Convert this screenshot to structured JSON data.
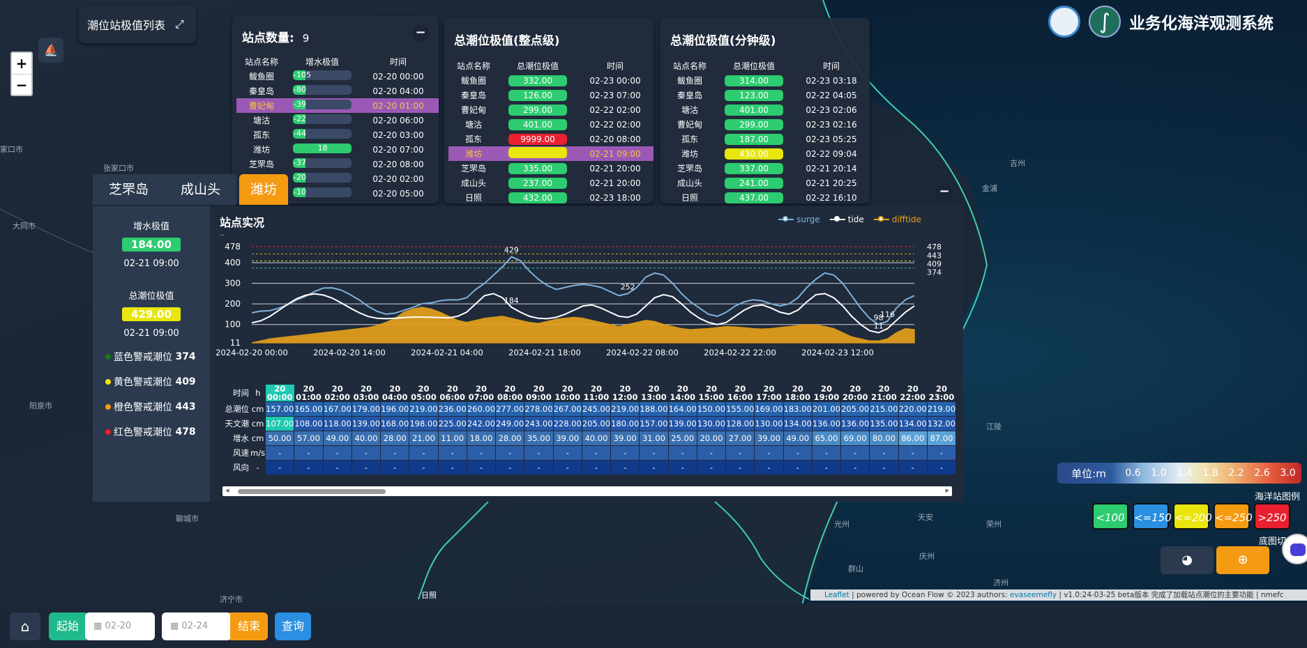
{
  "top_left_button": "潮位站极值列表",
  "zoom": {
    "plus": "+",
    "minus": "−"
  },
  "map_labels": [
    {
      "text": "张家口市"
    },
    {
      "text": "大同市"
    },
    {
      "text": "阳泉市"
    },
    {
      "text": "聊城市"
    },
    {
      "text": "济宁市"
    },
    {
      "text": "吉州"
    },
    {
      "text": "金浦"
    },
    {
      "text": "江陵"
    },
    {
      "text": "光州"
    },
    {
      "text": "济州"
    },
    {
      "text": "日照"
    },
    {
      "text": "天安"
    },
    {
      "text": "荣州"
    },
    {
      "text": "群山"
    },
    {
      "text": "庆州"
    },
    {
      "text": "家口市"
    }
  ],
  "panel_count": {
    "title": "站点数量:",
    "count": "9",
    "headers": [
      "站点名称",
      "增水极值",
      "时间"
    ],
    "rows": [
      {
        "name": "鲅鱼圈",
        "value": "-105",
        "fill": 0.05,
        "time": "02-20 00:00"
      },
      {
        "name": "秦皇岛",
        "value": "-80",
        "fill": 0.08,
        "time": "02-20 04:00"
      },
      {
        "name": "曹妃甸",
        "value": "-39",
        "fill": 0.05,
        "time": "02-20 01:00",
        "highlight": true
      },
      {
        "name": "塘沽",
        "value": "-22",
        "fill": 0.05,
        "time": "02-20 06:00"
      },
      {
        "name": "孤东",
        "value": "-44",
        "fill": 0.05,
        "time": "02-20 03:00"
      },
      {
        "name": "潍坊",
        "value": "18",
        "fill": 1.0,
        "time": "02-20 07:00"
      },
      {
        "name": "芝罘岛",
        "value": "-37",
        "fill": 0.05,
        "time": "02-20 08:00"
      },
      {
        "name": "成山头",
        "value": "-20",
        "fill": 0.05,
        "time": "02-20 02:00"
      },
      {
        "name": "日照",
        "value": "-10",
        "fill": 0.05,
        "time": "02-20 05:00"
      }
    ]
  },
  "panel_hour": {
    "title": "总潮位极值(整点级)",
    "headers": [
      "站点名称",
      "总潮位极值",
      "时间"
    ],
    "rows": [
      {
        "name": "鲅鱼圈",
        "value": "332.00",
        "color": "green",
        "time": "02-23 00:00"
      },
      {
        "name": "秦皇岛",
        "value": "126.00",
        "color": "green",
        "time": "02-23 07:00"
      },
      {
        "name": "曹妃甸",
        "value": "299.00",
        "color": "green",
        "time": "02-22 02:00"
      },
      {
        "name": "塘沽",
        "value": "401.00",
        "color": "green",
        "time": "02-22 02:00"
      },
      {
        "name": "孤东",
        "value": "9999.00",
        "color": "red",
        "time": "02-20 08:00"
      },
      {
        "name": "潍坊",
        "value": "",
        "color": "yellow",
        "time": "02-21 09:00",
        "highlight": true
      },
      {
        "name": "芝罘岛",
        "value": "335.00",
        "color": "green",
        "time": "02-21 20:00"
      },
      {
        "name": "成山头",
        "value": "237.00",
        "color": "green",
        "time": "02-21 20:00"
      },
      {
        "name": "日照",
        "value": "432.00",
        "color": "green",
        "time": "02-23 18:00"
      }
    ]
  },
  "panel_min": {
    "title": "总潮位极值(分钟级)",
    "headers": [
      "站点名称",
      "总潮位极值",
      "时间"
    ],
    "rows": [
      {
        "name": "鲅鱼圈",
        "value": "314.00",
        "color": "green",
        "time": "02-23 03:18"
      },
      {
        "name": "秦皇岛",
        "value": "123.00",
        "color": "green",
        "time": "02-22 04:05"
      },
      {
        "name": "塘沽",
        "value": "401.00",
        "color": "green",
        "time": "02-23 02:06"
      },
      {
        "name": "曹妃甸",
        "value": "299.00",
        "color": "green",
        "time": "02-23 02:16"
      },
      {
        "name": "孤东",
        "value": "187.00",
        "color": "green",
        "time": "02-23 05:25"
      },
      {
        "name": "潍坊",
        "value": "430.00",
        "color": "yellow",
        "time": "02-22 09:04"
      },
      {
        "name": "芝罘岛",
        "value": "337.00",
        "color": "green",
        "time": "02-21 20:14"
      },
      {
        "name": "成山头",
        "value": "241.00",
        "color": "green",
        "time": "02-21 20:25"
      },
      {
        "name": "日照",
        "value": "437.00",
        "color": "green",
        "time": "02-22 16:10"
      }
    ]
  },
  "tabs": [
    "芝罘岛",
    "成山头",
    "潍坊"
  ],
  "active_tab": 2,
  "station_info": {
    "surge_label": "增水极值",
    "surge_value": "184.00",
    "surge_time": "02-21 09:00",
    "total_label": "总潮位极值",
    "total_value": "429.00",
    "total_time": "02-21 09:00",
    "warnings": [
      {
        "label": "蓝色警戒潮位",
        "value": "374",
        "color": "#1a7a1a"
      },
      {
        "label": "黄色警戒潮位",
        "value": "409",
        "color": "#f2e60a"
      },
      {
        "label": "橙色警戒潮位",
        "value": "443",
        "color": "#f59b12"
      },
      {
        "label": "红色警戒潮位",
        "value": "478",
        "color": "#e8202f"
      }
    ]
  },
  "chart_title": "站点实况",
  "chart_subtitle": "--",
  "chart_data": {
    "type": "line",
    "legend": [
      "surge",
      "tide",
      "difftide"
    ],
    "xlabels": [
      "2024-02-20 00:00",
      "2024-02-20 14:00",
      "2024-02-21 04:00",
      "2024-02-21 18:00",
      "2024-02-22 08:00",
      "2024-02-22 22:00",
      "2024-02-23 12:00"
    ],
    "yticks": [
      11,
      100,
      200,
      300,
      400,
      478
    ],
    "ylim": [
      11,
      478
    ],
    "thresholds": [
      {
        "value": 478,
        "color": "#e8202f",
        "label": "478"
      },
      {
        "value": 443,
        "color": "#f59b12",
        "label": "443"
      },
      {
        "value": 409,
        "color": "#e8e60d",
        "label": "409"
      },
      {
        "value": 374,
        "color": "#1fc9b3",
        "label": "374"
      }
    ],
    "annotations": [
      {
        "label": "429"
      },
      {
        "label": "184"
      },
      {
        "label": "252"
      },
      {
        "label": "116"
      },
      {
        "label": "11"
      },
      {
        "label": "98"
      }
    ],
    "series": [
      {
        "name": "surge",
        "color": "#7fb2d9",
        "values": [
          157,
          165,
          167,
          179,
          196,
          219,
          236,
          260,
          277,
          278,
          267,
          245,
          219,
          188,
          164,
          150,
          155,
          169,
          183,
          201,
          205,
          215,
          220,
          219,
          230,
          270,
          300,
          340,
          380,
          429,
          410,
          360,
          320,
          290,
          270,
          280,
          290,
          295,
          290,
          280,
          260,
          240,
          250,
          280,
          330,
          350,
          340,
          300,
          250,
          210,
          180,
          150,
          140,
          160,
          190,
          210,
          220,
          215,
          200,
          190,
          200,
          230,
          280,
          320,
          350,
          340,
          300,
          240,
          180,
          130,
          100,
          116,
          180,
          220,
          240
        ]
      },
      {
        "name": "tide",
        "color": "#ffffff",
        "values": [
          108,
          118,
          139,
          168,
          198,
          225,
          242,
          249,
          243,
          228,
          205,
          180,
          157,
          139,
          130,
          128,
          130,
          134,
          136,
          136,
          135,
          134,
          132,
          140,
          160,
          200,
          240,
          250,
          230,
          184,
          160,
          140,
          130,
          128,
          135,
          150,
          170,
          190,
          195,
          180,
          160,
          140,
          135,
          150,
          190,
          230,
          245,
          235,
          200,
          160,
          130,
          110,
          100,
          110,
          140,
          170,
          190,
          195,
          180,
          160,
          150,
          170,
          210,
          245,
          250,
          230,
          190,
          140,
          100,
          70,
          60,
          80,
          120,
          160,
          190
        ]
      },
      {
        "name": "difftide",
        "color": "#e8a21a",
        "values": [
          11,
          20,
          30,
          35,
          40,
          45,
          50,
          55,
          60,
          65,
          70,
          75,
          80,
          85,
          95,
          110,
          130,
          160,
          175,
          184,
          175,
          160,
          140,
          120,
          110,
          120,
          130,
          135,
          140,
          130,
          120,
          110,
          105,
          115,
          125,
          130,
          135,
          130,
          120,
          110,
          100,
          90,
          100,
          110,
          120,
          115,
          100,
          90,
          80,
          75,
          78,
          80,
          85,
          90,
          88,
          84,
          80,
          78,
          80,
          85,
          90,
          95,
          100,
          98,
          90,
          80,
          60,
          40,
          30,
          20,
          20,
          30,
          60,
          80,
          75
        ]
      }
    ]
  },
  "data_table": {
    "headers": [
      "20\n00:00",
      "20\n01:00",
      "20\n02:00",
      "20\n03:00",
      "20\n04:00",
      "20\n05:00",
      "20\n06:00",
      "20\n07:00",
      "20\n08:00",
      "20\n09:00",
      "20\n10:00",
      "20\n11:00",
      "20\n12:00",
      "20\n13:00",
      "20\n14:00",
      "20\n15:00",
      "20\n16:00",
      "20\n17:00",
      "20\n18:00",
      "20\n19:00",
      "20\n20:00",
      "20\n21:00",
      "20\n22:00",
      "20\n23:00"
    ],
    "rows": [
      {
        "label": "时间",
        "unit": "h"
      },
      {
        "label": "总潮位",
        "unit": "cm",
        "values": [
          "157.00",
          "165.00",
          "167.00",
          "179.00",
          "196.00",
          "219.00",
          "236.00",
          "260.00",
          "277.00",
          "278.00",
          "267.00",
          "245.00",
          "219.00",
          "188.00",
          "164.00",
          "150.00",
          "155.00",
          "169.00",
          "183.00",
          "201.00",
          "205.00",
          "215.00",
          "220.00",
          "219.00"
        ]
      },
      {
        "label": "天文潮",
        "unit": "cm",
        "values": [
          "107.00",
          "108.00",
          "118.00",
          "139.00",
          "168.00",
          "198.00",
          "225.00",
          "242.00",
          "249.00",
          "243.00",
          "228.00",
          "205.00",
          "180.00",
          "157.00",
          "139.00",
          "130.00",
          "128.00",
          "130.00",
          "134.00",
          "136.00",
          "136.00",
          "135.00",
          "134.00",
          "132.00"
        ]
      },
      {
        "label": "增水",
        "unit": "cm",
        "values": [
          "50.00",
          "57.00",
          "49.00",
          "40.00",
          "28.00",
          "21.00",
          "11.00",
          "18.00",
          "28.00",
          "35.00",
          "39.00",
          "40.00",
          "39.00",
          "31.00",
          "25.00",
          "20.00",
          "27.00",
          "39.00",
          "49.00",
          "65.00",
          "69.00",
          "80.00",
          "86.00",
          "87.00"
        ]
      },
      {
        "label": "风速",
        "unit": "m/s",
        "values": [
          "-",
          "-",
          "-",
          "-",
          "-",
          "-",
          "-",
          "-",
          "-",
          "-",
          "-",
          "-",
          "-",
          "-",
          "-",
          "-",
          "-",
          "-",
          "-",
          "-",
          "-",
          "-",
          "-",
          "-"
        ]
      },
      {
        "label": "风向",
        "unit": "-",
        "values": [
          "-",
          "-",
          "-",
          "-",
          "-",
          "-",
          "-",
          "-",
          "-",
          "-",
          "-",
          "-",
          "-",
          "-",
          "-",
          "-",
          "-",
          "-",
          "-",
          "-",
          "-",
          "-",
          "-",
          "-"
        ]
      }
    ]
  },
  "logo_title": "业务化海洋观测系统",
  "scale": {
    "unit": "单位:m",
    "ticks": [
      "0.6",
      "1.0",
      "1.4",
      "1.8",
      "2.2",
      "2.6",
      "3.0"
    ]
  },
  "station_legend": {
    "title": "海洋站图例",
    "items": [
      {
        "label": "<100",
        "color": "#2dcc70",
        "text_color": "#fff"
      },
      {
        "label": "<=150",
        "color": "#2a8fe0",
        "text_color": "#fff"
      },
      {
        "label": "<=200",
        "color": "#e8e60d",
        "text_color": "#fff"
      },
      {
        "label": "<=250",
        "color": "#f59b12",
        "text_color": "#fff"
      },
      {
        "label": ">250",
        "color": "#e8202f",
        "text_color": "#fff"
      }
    ]
  },
  "base_map_title": "底图切",
  "attribution": {
    "leaflet": "Leaflet",
    "text1": " | powered by Ocean Flow © 2023 authors: ",
    "author": "evaseemefly",
    "text2": " | v1.0:24-03-25 beta版本 完成了加载站点潮位的主要功能 | nmefc"
  },
  "bottom": {
    "start": "起始",
    "start_date": "02-20",
    "end_date": "02-24",
    "end": "结束",
    "query": "查询"
  }
}
